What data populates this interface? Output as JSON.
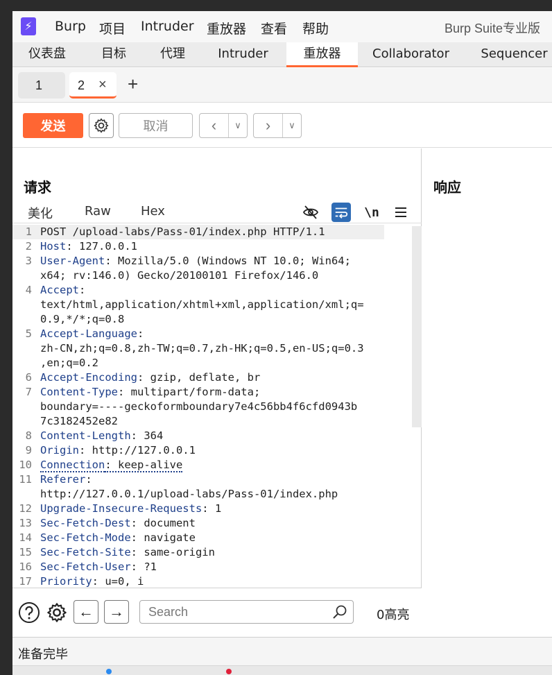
{
  "menubar": {
    "items": [
      "Burp",
      "项目",
      "Intruder",
      "重放器",
      "查看",
      "帮助"
    ],
    "app_title": "Burp Suite专业版"
  },
  "main_tabs": [
    {
      "label": "仪表盘"
    },
    {
      "label": "目标"
    },
    {
      "label": "代理"
    },
    {
      "label": "Intruder"
    },
    {
      "label": "重放器",
      "active": true
    },
    {
      "label": "Collaborator"
    },
    {
      "label": "Sequencer"
    }
  ],
  "sub_tabs": [
    {
      "label": "1"
    },
    {
      "label": "2",
      "active": true
    }
  ],
  "toolbar": {
    "send_label": "发送",
    "cancel_label": "取消"
  },
  "request": {
    "title": "请求",
    "view_tabs": [
      "美化",
      "Raw",
      "Hex"
    ],
    "newline_toggle": "\\n"
  },
  "response": {
    "title": "响应"
  },
  "code_lines": [
    {
      "n": "1",
      "parts": [
        {
          "t": "POST /upload-labs/Pass-01/index.php HTTP/1.1"
        }
      ]
    },
    {
      "n": "2",
      "parts": [
        {
          "t": "Host",
          "h": true
        },
        {
          "t": ": 127.0.0.1"
        }
      ]
    },
    {
      "n": "3",
      "parts": [
        {
          "t": "User-Agent",
          "h": true
        },
        {
          "t": ": Mozilla/5.0 (Windows NT 10.0; Win64;"
        }
      ]
    },
    {
      "n": "",
      "parts": [
        {
          "t": "x64; rv:146.0) Gecko/20100101 Firefox/146.0"
        }
      ]
    },
    {
      "n": "4",
      "parts": [
        {
          "t": "Accept",
          "h": true
        },
        {
          "t": ":"
        }
      ]
    },
    {
      "n": "",
      "parts": [
        {
          "t": "text/html,application/xhtml+xml,application/xml;q="
        }
      ]
    },
    {
      "n": "",
      "parts": [
        {
          "t": "0.9,*/*;q=0.8"
        }
      ]
    },
    {
      "n": "5",
      "parts": [
        {
          "t": "Accept-Language",
          "h": true
        },
        {
          "t": ":"
        }
      ]
    },
    {
      "n": "",
      "parts": [
        {
          "t": "zh-CN,zh;q=0.8,zh-TW;q=0.7,zh-HK;q=0.5,en-US;q=0.3"
        }
      ]
    },
    {
      "n": "",
      "parts": [
        {
          "t": ",en;q=0.2"
        }
      ]
    },
    {
      "n": "6",
      "parts": [
        {
          "t": "Accept-Encoding",
          "h": true
        },
        {
          "t": ": gzip, deflate, br"
        }
      ]
    },
    {
      "n": "7",
      "parts": [
        {
          "t": "Content-Type",
          "h": true
        },
        {
          "t": ": multipart/form-data;"
        }
      ]
    },
    {
      "n": "",
      "parts": [
        {
          "t": "boundary=----geckoformboundary7e4c56bb4f6cfd0943b"
        }
      ]
    },
    {
      "n": "",
      "parts": [
        {
          "t": "7c3182452e82"
        }
      ]
    },
    {
      "n": "8",
      "parts": [
        {
          "t": "Content-Length",
          "h": true
        },
        {
          "t": ": 364"
        }
      ]
    },
    {
      "n": "9",
      "parts": [
        {
          "t": "Origin",
          "h": true
        },
        {
          "t": ": http://127.0.0.1"
        }
      ]
    },
    {
      "n": "10",
      "parts": [
        {
          "t": "Connection",
          "h": true,
          "dotted": true
        },
        {
          "t": ": keep-alive",
          "dotted": true
        }
      ]
    },
    {
      "n": "11",
      "parts": [
        {
          "t": "Referer",
          "h": true
        },
        {
          "t": ":"
        }
      ]
    },
    {
      "n": "",
      "parts": [
        {
          "t": "http://127.0.0.1/upload-labs/Pass-01/index.php"
        }
      ]
    },
    {
      "n": "12",
      "parts": [
        {
          "t": "Upgrade-Insecure-Requests",
          "h": true
        },
        {
          "t": ": 1"
        }
      ]
    },
    {
      "n": "13",
      "parts": [
        {
          "t": "Sec-Fetch-Dest",
          "h": true
        },
        {
          "t": ": document"
        }
      ]
    },
    {
      "n": "14",
      "parts": [
        {
          "t": "Sec-Fetch-Mode",
          "h": true
        },
        {
          "t": ": navigate"
        }
      ]
    },
    {
      "n": "15",
      "parts": [
        {
          "t": "Sec-Fetch-Site",
          "h": true
        },
        {
          "t": ": same-origin"
        }
      ]
    },
    {
      "n": "16",
      "parts": [
        {
          "t": "Sec-Fetch-User",
          "h": true
        },
        {
          "t": ": ?1"
        }
      ]
    },
    {
      "n": "17",
      "parts": [
        {
          "t": "Priority",
          "h": true
        },
        {
          "t": ": u=0, i"
        }
      ]
    }
  ],
  "search": {
    "placeholder": "Search",
    "highlight_count": "0高亮"
  },
  "status": {
    "text": "准备完毕"
  },
  "colors": {
    "accent": "#ff6633",
    "header_name": "#1e3f8a",
    "active_tool": "#2f6cb5",
    "logo": "#6a4cf5"
  },
  "icons": {
    "logo": "burp-logo-icon",
    "settings": "gear-icon",
    "hide": "eye-slash-icon",
    "wrap": "word-wrap-icon",
    "menu": "hamburger-menu-icon",
    "help": "question-icon",
    "search": "magnifier-icon"
  }
}
